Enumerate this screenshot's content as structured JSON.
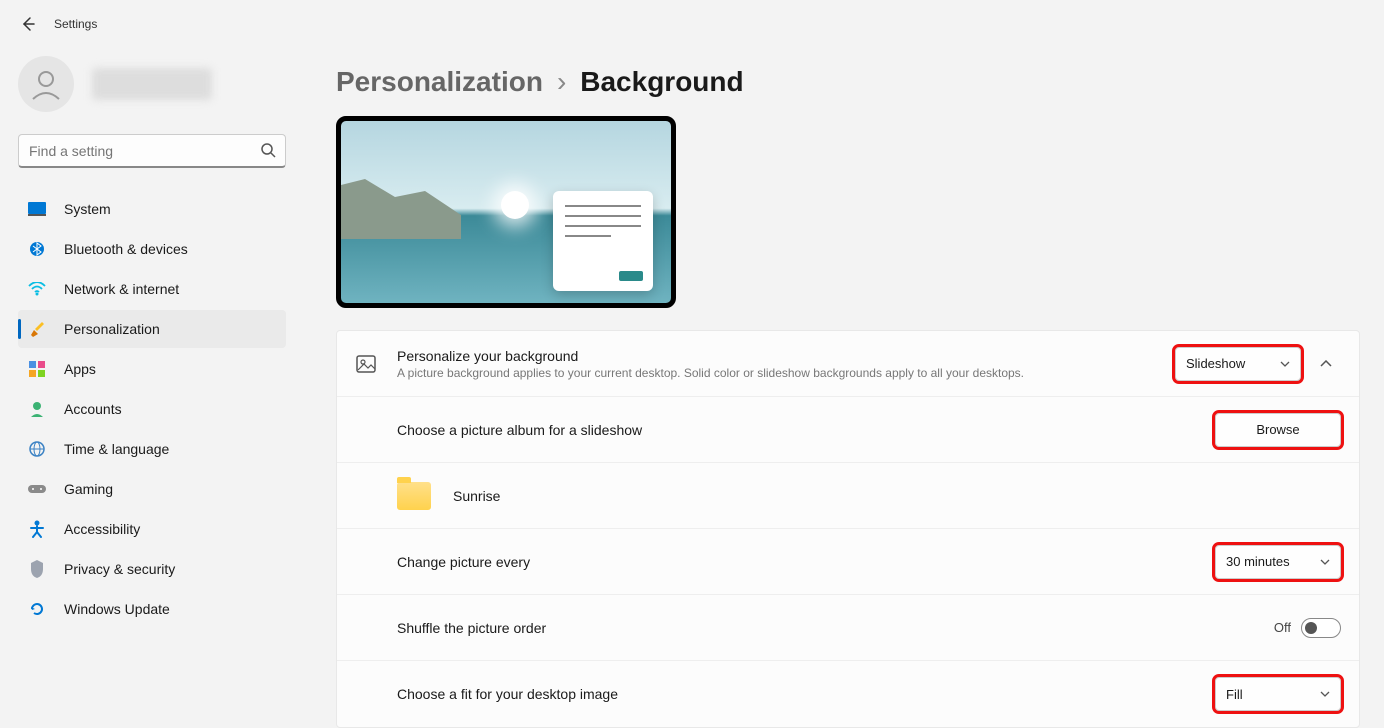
{
  "app_title": "Settings",
  "search": {
    "placeholder": "Find a setting"
  },
  "nav": {
    "items": [
      {
        "label": "System"
      },
      {
        "label": "Bluetooth & devices"
      },
      {
        "label": "Network & internet"
      },
      {
        "label": "Personalization"
      },
      {
        "label": "Apps"
      },
      {
        "label": "Accounts"
      },
      {
        "label": "Time & language"
      },
      {
        "label": "Gaming"
      },
      {
        "label": "Accessibility"
      },
      {
        "label": "Privacy & security"
      },
      {
        "label": "Windows Update"
      }
    ]
  },
  "breadcrumb": {
    "parent": "Personalization",
    "current": "Background"
  },
  "settings": {
    "personalize_bg": {
      "title": "Personalize your background",
      "desc": "A picture background applies to your current desktop. Solid color or slideshow backgrounds apply to all your desktops.",
      "value": "Slideshow"
    },
    "album": {
      "title": "Choose a picture album for a slideshow",
      "browse": "Browse",
      "folder": "Sunrise"
    },
    "interval": {
      "title": "Change picture every",
      "value": "30 minutes"
    },
    "shuffle": {
      "title": "Shuffle the picture order",
      "state": "Off"
    },
    "fit": {
      "title": "Choose a fit for your desktop image",
      "value": "Fill"
    }
  }
}
